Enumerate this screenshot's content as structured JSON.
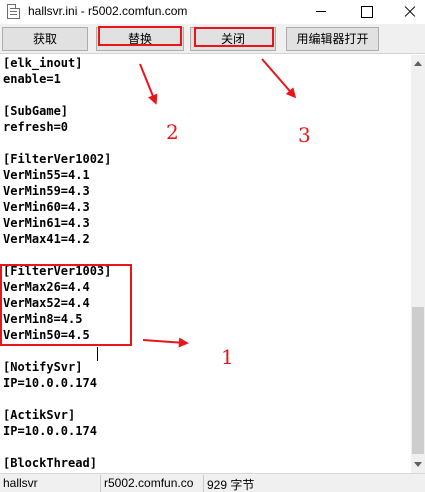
{
  "window": {
    "title": "hallsvr.ini - r5002.comfun.com"
  },
  "toolbar": {
    "get_label": "获取",
    "replace_label": "替换",
    "close_label": "关闭",
    "open_editor_label": "用编辑器打开"
  },
  "editor": {
    "lines": [
      "[elk_inout]",
      "enable=1",
      "",
      "[SubGame]",
      "refresh=0",
      "",
      "[FilterVer1002]",
      "VerMin55=4.1",
      "VerMin59=4.3",
      "VerMin60=4.3",
      "VerMin61=4.3",
      "VerMax41=4.2",
      "",
      "[FilterVer1003]",
      "VerMax26=4.4",
      "VerMax52=4.4",
      "VerMin8=4.5",
      "VerMin50=4.5",
      "",
      "[NotifySvr]",
      "IP=10.0.0.174",
      "",
      "[ActikSvr]",
      "IP=10.0.0.174",
      "",
      "[BlockThread]"
    ]
  },
  "annotations": {
    "label_1": "1",
    "label_2": "2",
    "label_3": "3",
    "color": "#e8151b"
  },
  "status": {
    "file": "hallsvr",
    "host": "r5002.comfun.co",
    "size": "929 字节"
  }
}
